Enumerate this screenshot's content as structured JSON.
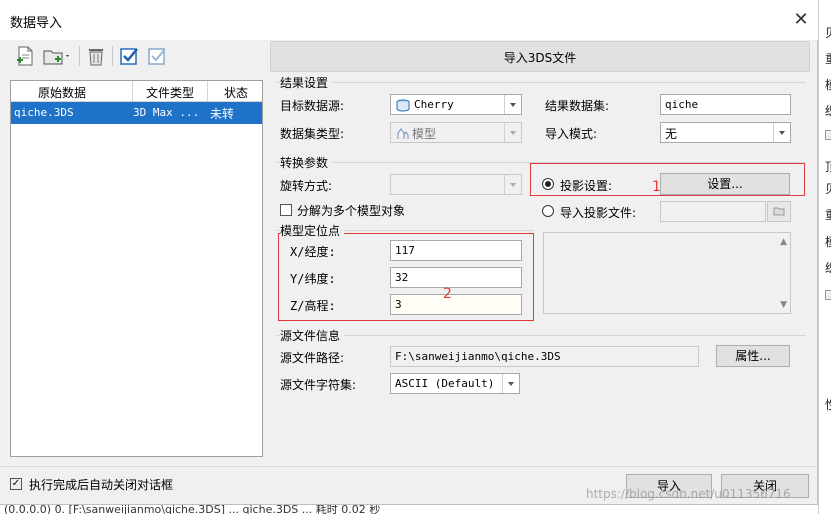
{
  "dialog": {
    "title": "数据导入",
    "close_glyph": "✕"
  },
  "toolbar": {
    "icons": [
      "new-file-icon",
      "add-folder-icon",
      "delete-icon",
      "check-all-icon",
      "check-none-icon"
    ]
  },
  "list": {
    "columns": [
      "原始数据",
      "文件类型",
      "状态"
    ],
    "rows": [
      {
        "source": "qiche.3DS",
        "type": "3D Max ...",
        "status": "未转"
      }
    ]
  },
  "panel": {
    "header": "导入3DS文件"
  },
  "result": {
    "section": "结果设置",
    "target_source_label": "目标数据源:",
    "target_source_value": "Cherry",
    "dataset_label": "结果数据集:",
    "dataset_value": "qiche",
    "dataset_type_label": "数据集类型:",
    "dataset_type_value": "模型",
    "import_mode_label": "导入模式:",
    "import_mode_value": "无"
  },
  "convert": {
    "section": "转换参数",
    "rotation_label": "旋转方式:",
    "split_label": "分解为多个模型对象",
    "projection_label": "投影设置:",
    "projection_button": "设置...",
    "import_projection_label": "导入投影文件:",
    "annotation_1": "1"
  },
  "position": {
    "section": "模型定位点",
    "x_label": "X/经度:",
    "x_value": "117",
    "y_label": "Y/纬度:",
    "y_value": "32",
    "z_label": "Z/高程:",
    "z_value": "3",
    "annotation_2": "2"
  },
  "source": {
    "section": "源文件信息",
    "path_label": "源文件路径:",
    "path_value": "F:\\sanweijianmo\\qiche.3DS",
    "properties_button": "属性...",
    "charset_label": "源文件字符集:",
    "charset_value": "ASCII (Default)"
  },
  "footer": {
    "auto_close_label": "执行完成后自动关闭对话框",
    "import_button": "导入",
    "close_button": "关闭",
    "watermark": "https://blog.csdn.net/u011356716"
  },
  "background": {
    "side_chars": [
      "贝",
      "重",
      "模",
      "织",
      "顶",
      "贝",
      "重",
      "模",
      "织",
      "性"
    ],
    "bottom_text": "(0.0.0.0) 0. [F:\\sanweijianmo\\qiche.3DS] ... qiche.3DS ... 耗时 0.02 秒"
  },
  "colors": {
    "selection": "#1e72c8",
    "annotation": "#e23a3a",
    "dialog_bg": "#f0f0f0"
  }
}
